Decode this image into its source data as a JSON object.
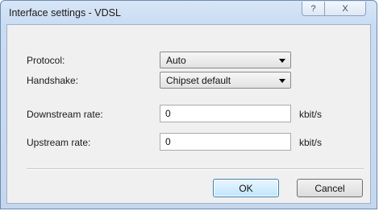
{
  "window": {
    "title": "Interface settings - VDSL",
    "help_glyph": "?",
    "close_glyph": "X"
  },
  "form": {
    "protocol": {
      "label": "Protocol:",
      "value": "Auto"
    },
    "handshake": {
      "label": "Handshake:",
      "value": "Chipset default"
    },
    "downstream": {
      "label": "Downstream rate:",
      "value": "0",
      "unit": "kbit/s"
    },
    "upstream": {
      "label": "Upstream rate:",
      "value": "0",
      "unit": "kbit/s"
    }
  },
  "buttons": {
    "ok": "OK",
    "cancel": "Cancel"
  },
  "colors": {
    "frame": "#c9dcf2",
    "client": "#f0f0f0",
    "default_button": "#bee6fd"
  }
}
